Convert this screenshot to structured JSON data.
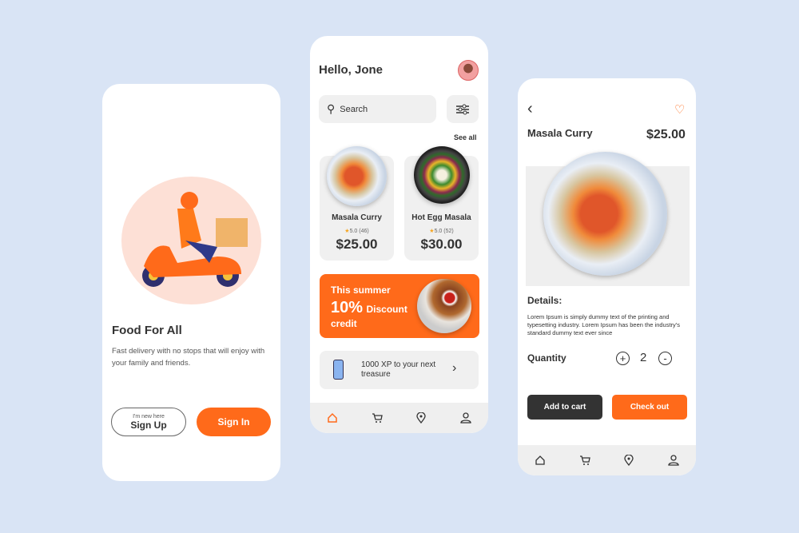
{
  "colors": {
    "accent": "#ff6a1a",
    "dark": "#333333",
    "background": "#d9e4f5"
  },
  "onboarding": {
    "title": "Food For All",
    "description": "Fast delivery with no stops that will enjoy with your family and friends.",
    "signup_hint": "I'm new here",
    "signup_label": "Sign Up",
    "signin_label": "Sign In"
  },
  "home": {
    "greeting": "Hello, Jone",
    "search_placeholder": "Search",
    "see_all": "See all",
    "items": [
      {
        "name": "Masala Curry",
        "rating": "5.0 (46)",
        "price": "$25.00"
      },
      {
        "name": "Hot Egg Masala",
        "rating": "5.0 (52)",
        "price": "$30.00"
      }
    ],
    "promo": {
      "line1": "This summer",
      "percent": "10%",
      "line2": "Discount",
      "line3": "credit"
    },
    "reward": {
      "text": "1000 XP to your next treasure"
    },
    "nav": [
      "home-icon",
      "cart-icon",
      "location-icon",
      "profile-icon"
    ]
  },
  "detail": {
    "title": "Masala Curry",
    "price": "$25.00",
    "details_label": "Details:",
    "description": "Lorem Ipsum is simply dummy text of the printing and typesetting industry. Lorem Ipsum has been the industry's standard dummy text ever since",
    "quantity_label": "Quantity",
    "quantity": "2",
    "add_to_cart": "Add to cart",
    "checkout": "Check out"
  }
}
